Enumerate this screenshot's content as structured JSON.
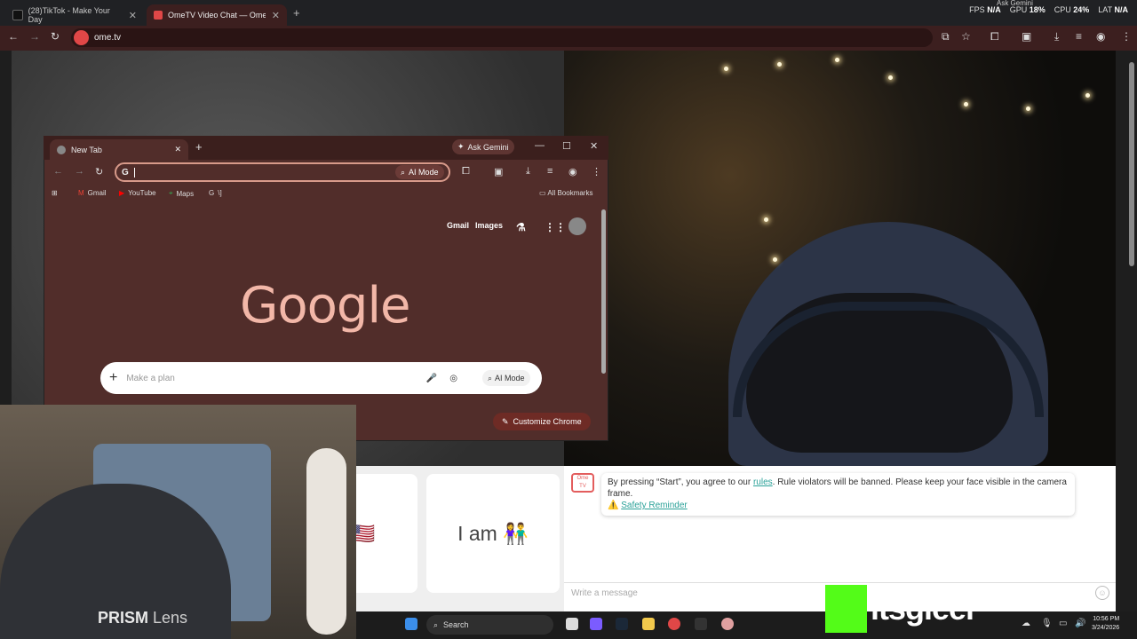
{
  "tabs": [
    {
      "label": "(28)TikTok - Make Your Day",
      "close": "✕"
    },
    {
      "label": "OmeTV Video Chat — Ome",
      "close": "✕"
    }
  ],
  "new_tab_symbol": "+",
  "stats": {
    "fps_label": "FPS",
    "fps_value": "N/A",
    "gpu_label": "GPU",
    "gpu_value": "18%",
    "cpu_label": "CPU",
    "cpu_value": "24%",
    "lat_label": "LAT",
    "lat_value": "N/A",
    "ask_gemini": "Ask Gemini"
  },
  "address": {
    "url": "ome.tv"
  },
  "inner_window": {
    "tab_label": "New Tab",
    "ask_gemini": "Ask Gemini",
    "omnibox_value": "",
    "ai_mode": "AI Mode",
    "bookmarks": [
      "Gmail",
      "YouTube",
      "Maps",
      "\\]"
    ],
    "all_bookmarks": "All Bookmarks",
    "header_links": [
      "Gmail",
      "Images"
    ],
    "logo_text": "Google",
    "search_placeholder": "Make a plan",
    "search_ai_mode": "AI Mode",
    "customize": "Customize Chrome"
  },
  "ome": {
    "choice_country": "ry 🇺🇸",
    "choice_gender": "I am 👫",
    "message_prefix": "By pressing “Start”, you agree to our ",
    "rules_link": "rules",
    "message_suffix": ". Rule violators will be banned. Please keep your face visible in the camera frame.",
    "safety_icon": "⚠️",
    "safety_link": "Safety Reminder",
    "chat_placeholder": "Write a message",
    "logo_text": "Ome TV"
  },
  "overlay": {
    "prism_bold": "PRISM",
    "prism_light": " Lens",
    "kick_handle": "itsgleel"
  },
  "taskbar": {
    "search_label": "Search",
    "time": "10:56 PM",
    "date": "3/24/2026"
  },
  "colors": {
    "brand_red": "#e04747",
    "kick_green": "#53fc18",
    "link_teal": "#2aa198"
  }
}
